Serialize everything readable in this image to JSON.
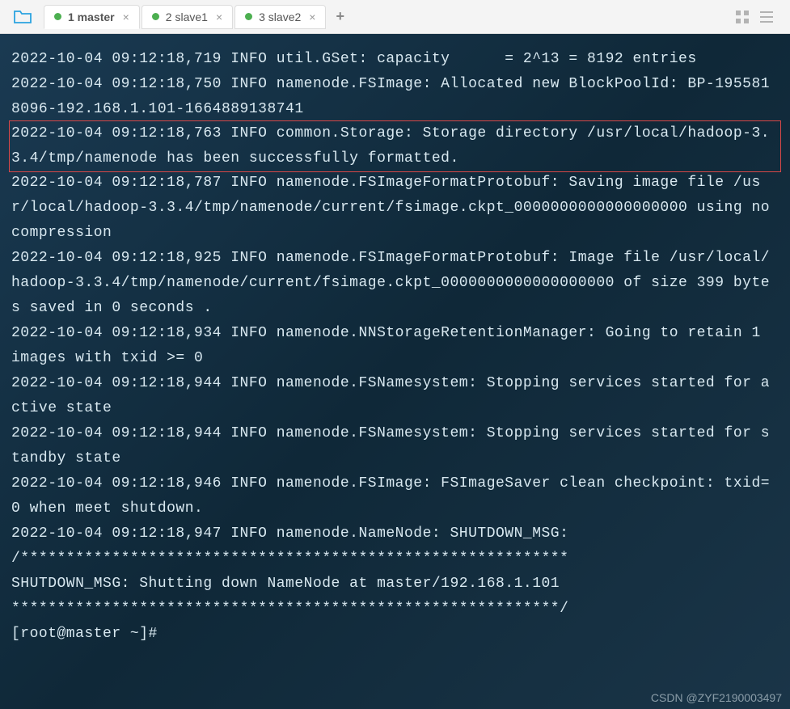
{
  "tabs": [
    {
      "label": "1 master",
      "active": true
    },
    {
      "label": "2 slave1",
      "active": false
    },
    {
      "label": "3 slave2",
      "active": false
    }
  ],
  "terminal": {
    "lines": [
      "2022-10-04 09:12:18,719 INFO util.GSet: capacity      = 2^13 = 8192 entries",
      "2022-10-04 09:12:18,750 INFO namenode.FSImage: Allocated new BlockPoolId: BP-1955818096-192.168.1.101-1664889138741",
      "2022-10-04 09:12:18,763 INFO common.Storage: Storage directory /usr/local/hadoop-3.3.4/tmp/namenode has been successfully formatted.",
      "2022-10-04 09:12:18,787 INFO namenode.FSImageFormatProtobuf: Saving image file /usr/local/hadoop-3.3.4/tmp/namenode/current/fsimage.ckpt_0000000000000000000 using no compression",
      "2022-10-04 09:12:18,925 INFO namenode.FSImageFormatProtobuf: Image file /usr/local/hadoop-3.3.4/tmp/namenode/current/fsimage.ckpt_0000000000000000000 of size 399 bytes saved in 0 seconds .",
      "2022-10-04 09:12:18,934 INFO namenode.NNStorageRetentionManager: Going to retain 1 images with txid >= 0",
      "2022-10-04 09:12:18,944 INFO namenode.FSNamesystem: Stopping services started for active state",
      "2022-10-04 09:12:18,944 INFO namenode.FSNamesystem: Stopping services started for standby state",
      "2022-10-04 09:12:18,946 INFO namenode.FSImage: FSImageSaver clean checkpoint: txid=0 when meet shutdown.",
      "2022-10-04 09:12:18,947 INFO namenode.NameNode: SHUTDOWN_MSG:",
      "/************************************************************",
      "SHUTDOWN_MSG: Shutting down NameNode at master/192.168.1.101",
      "************************************************************/",
      "[root@master ~]#"
    ],
    "highlighted_index": 2
  },
  "watermark": "CSDN @ZYF2190003497"
}
